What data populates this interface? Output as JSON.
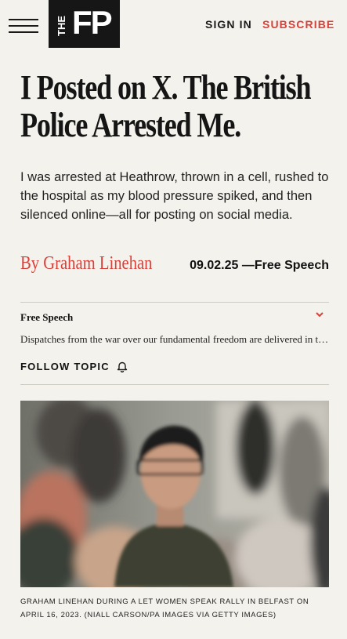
{
  "header": {
    "logo_the": "THE",
    "logo_fp": "FP",
    "sign_in": "SIGN IN",
    "subscribe": "SUBSCRIBE"
  },
  "article": {
    "headline": "I Posted on X. The British Police Arrested Me.",
    "dek": "I was arrested at Heathrow, thrown in a cell, rushed to the hospital as my blood pressure spiked, and then silenced online—all for posting on social media.",
    "byline": "By Graham Linehan",
    "date_section": "09.02.25 —Free Speech"
  },
  "topic": {
    "name": "Free Speech",
    "description": "Dispatches from the war over our fundamental freedom are delivered in this section for readers of The Free Press.",
    "follow_label": "FOLLOW TOPIC"
  },
  "photo": {
    "caption": "GRAHAM LINEHAN DURING A LET WOMEN SPEAK RALLY IN BELFAST ON APRIL 16, 2023. (NIALL CARSON/PA IMAGES VIA GETTY IMAGES)"
  },
  "colors": {
    "accent": "#d8413a",
    "background": "#f4f2ec",
    "logo_bg": "#161616"
  },
  "icons": {
    "menu": "hamburger-menu-icon",
    "expand": "chevron-down-icon",
    "follow": "bell-icon"
  }
}
